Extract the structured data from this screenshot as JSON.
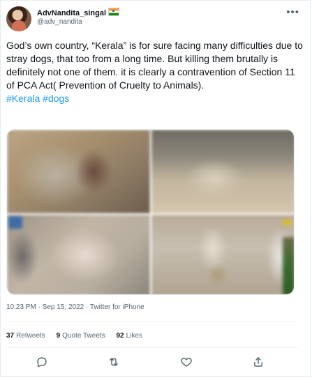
{
  "tweet": {
    "author_name": "AdvNandita_singal",
    "author_handle": "@adv_nandita",
    "more_label": "•••",
    "text": "God’s own country, “Kerala” is for sure facing many difficulties due to stray dogs, that too from a long time. But killing them brutally is definitely not one of them. it is clearly a contravention of Section 11 of PCA Act( Prevention of Cruelty to Animals).",
    "hashtags": "#Kerala #dogs",
    "meta": "10:23 PM · Sep 15, 2022 · Twitter for iPhone"
  },
  "stats": {
    "retweets_count": "37",
    "retweets_label": "Retweets",
    "quote_tweets_count": "9",
    "quote_tweets_label": "Quote Tweets",
    "likes_count": "92",
    "likes_label": "Likes"
  },
  "actions": [
    {
      "icon": "reply-icon"
    },
    {
      "icon": "retweet-icon"
    },
    {
      "icon": "like-icon"
    },
    {
      "icon": "share-icon"
    }
  ],
  "colors": {
    "accent": "#1d9bf0",
    "text": "#0f1419",
    "secondary": "#536471"
  }
}
